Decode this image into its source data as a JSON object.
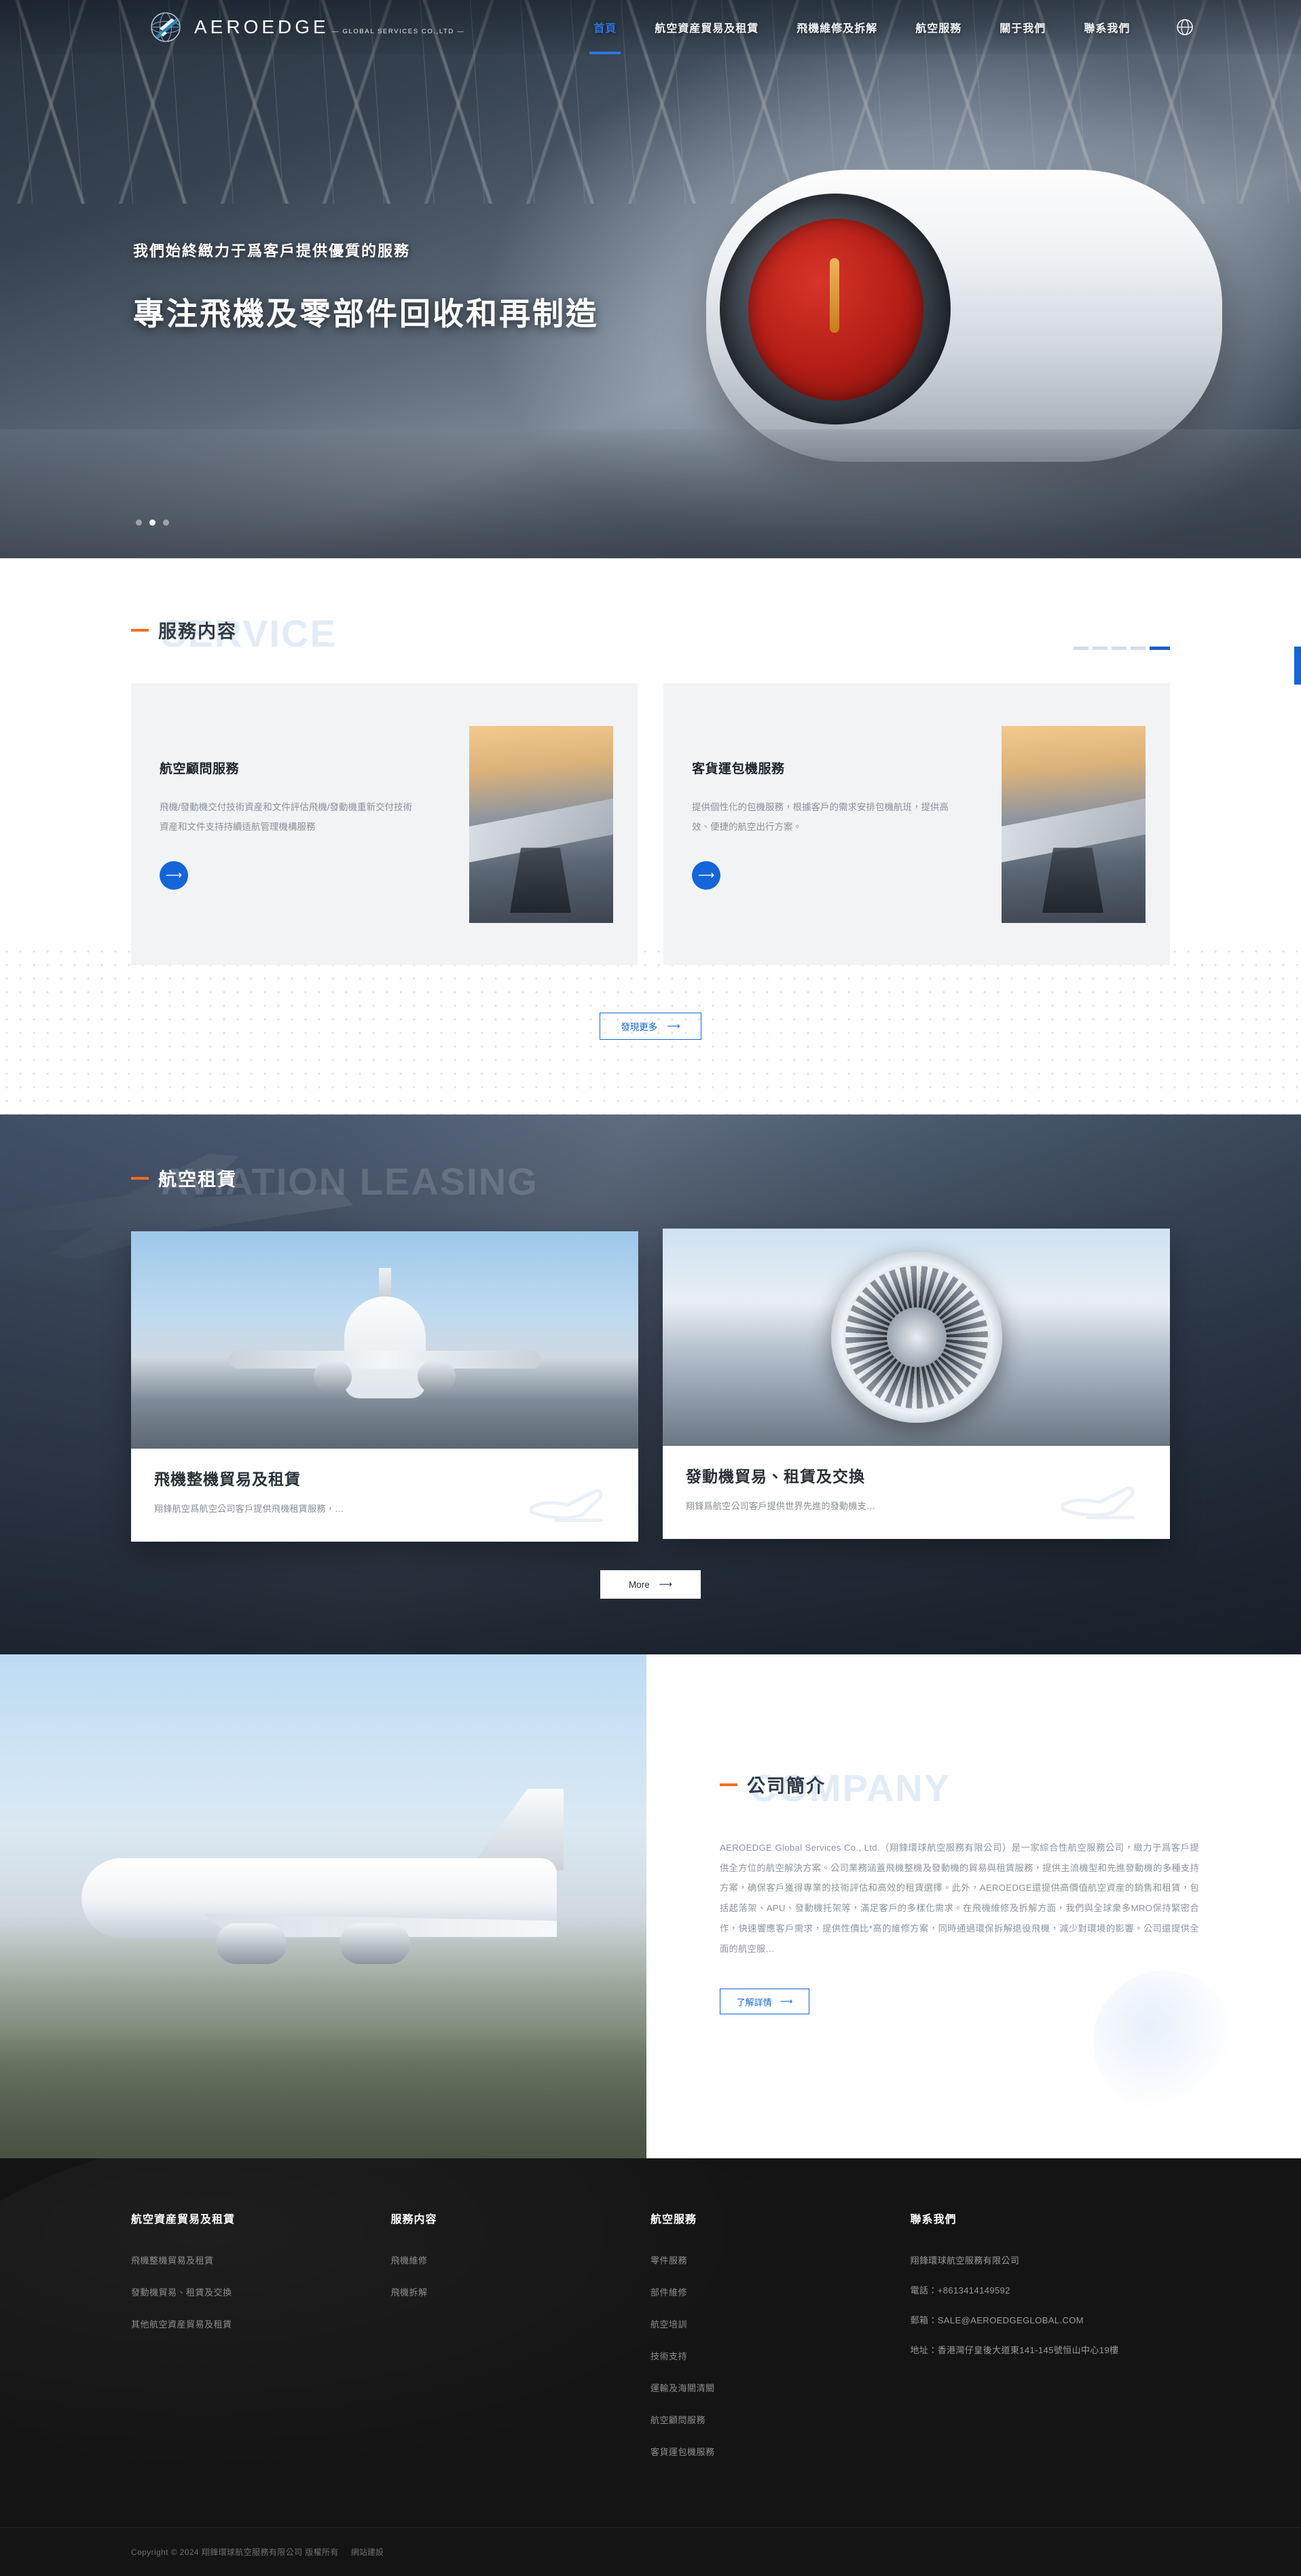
{
  "brand": {
    "name": "AEROEDGE",
    "tagline": "— GLOBAL SERVICES CO.,LTD —",
    "logo_icon": "globe-airplane-logo-icon"
  },
  "nav": {
    "items": [
      {
        "label": "首頁",
        "active": true
      },
      {
        "label": "航空資産貿易及租賃",
        "active": false
      },
      {
        "label": "飛機維修及拆解",
        "active": false
      },
      {
        "label": "航空服務",
        "active": false
      },
      {
        "label": "關于我們",
        "active": false
      },
      {
        "label": "聯系我們",
        "active": false
      }
    ],
    "language_icon": "globe-icon",
    "active_color": "#2f74e0"
  },
  "hero": {
    "subtitle": "我們始終緻力于爲客戶提供優質的服務",
    "title": "專注飛機及零部件回收和再制造",
    "slide_dots": 3,
    "active_dot": 2
  },
  "service": {
    "ghost_title": "SERVICE",
    "title": "服務内容",
    "accent_color": "#f36f21",
    "pager": {
      "total": 5,
      "active": 5,
      "active_color": "#1e60c8"
    },
    "cards": [
      {
        "name": "航空顧問服務",
        "desc": "飛機/發動機交付技術資産和文件評估飛機/發動機重新交付技術資産和文件支持持續适航管理機構服務",
        "arrow_icon": "arrow-right-icon",
        "image": "aircraft-landing-gear-photo"
      },
      {
        "name": "客貨運包機服務",
        "desc": "提供個性化的包機服務，根據客戶的需求安排包機航班，提供高效、便捷的航空出行方案。",
        "arrow_icon": "arrow-right-icon",
        "image": "aircraft-landing-gear-photo"
      }
    ],
    "more_button": {
      "label": "發現更多",
      "icon": "arrow-right-icon"
    }
  },
  "leasing": {
    "ghost_title": "AVIATION LEASING",
    "title": "航空租賃",
    "accent_color": "#f36f21",
    "cards": [
      {
        "name": "飛機整機貿易及租賃",
        "desc": "翔鋒航空爲航空公司客戶提供飛機租賃服務，…",
        "image": "airliner-front-view-photo",
        "watermark_icon": "airplane-takeoff-icon"
      },
      {
        "name": "發動機貿易、租賃及交換",
        "desc": "翔鋒爲航空公司客戶提供世界先進的發動機支…",
        "image": "jet-engine-fan-photo",
        "watermark_icon": "airplane-takeoff-icon"
      }
    ],
    "more_button": {
      "label": "More",
      "icon": "arrow-right-icon"
    }
  },
  "company": {
    "ghost_title": "COMPANY",
    "title": "公司簡介",
    "accent_color": "#f36f21",
    "image": "airliner-on-runway-photo",
    "description": "AEROEDGE Global Services Co., Ltd.（翔鋒環球航空服務有限公司）是一家綜合性航空服務公司，緻力于爲客戶提供全方位的航空解決方案。公司業務涵蓋飛機整機及發動機的貿易與租賃服務，提供主流機型和先進發動機的多種支持方案，确保客戶獲得專業的技術評估和高效的租賃選擇。此外，AEROEDGE還提供高價值航空資産的銷售和租賃，包括起落架、APU、發動機托架等，滿足客戶的多樣化需求。在飛機維修及拆解方面，我們與全球衆多MRO保持緊密合作，快速響應客戶需求，提供性價比*高的維修方案，同時通過環保拆解退役飛機，減少對環境的影響。公司還提供全面的航空服…",
    "detail_button": {
      "label": "了解詳情",
      "icon": "arrow-right-icon"
    }
  },
  "footer": {
    "columns": [
      {
        "head": "航空資産貿易及租賃",
        "links": [
          "飛機整機貿易及租賃",
          "發動機貿易、租賃及交換",
          "其他航空資産貿易及租賃"
        ]
      },
      {
        "head": "服務内容",
        "links": [
          "飛機維修",
          "飛機拆解"
        ]
      },
      {
        "head": "航空服務",
        "links": [
          "零件服務",
          "部件維修",
          "航空培訓",
          "技術支持",
          "運輸及海關清關",
          "航空顧問服務",
          "客貨運包機服務"
        ]
      }
    ],
    "contact": {
      "head": "聯系我們",
      "company": "翔鋒環球航空服務有限公司",
      "phone": "電話：+8613414149592",
      "email": "郵箱：SALE@AEROEDGEGLOBAL.COM",
      "address": "地址：香港灣仔皇後大道東141-145號恒山中心19樓"
    },
    "copyright": "Copyright © 2024 翔鋒環球航空服務有限公司 版權所有",
    "built_by": "網站建設"
  }
}
